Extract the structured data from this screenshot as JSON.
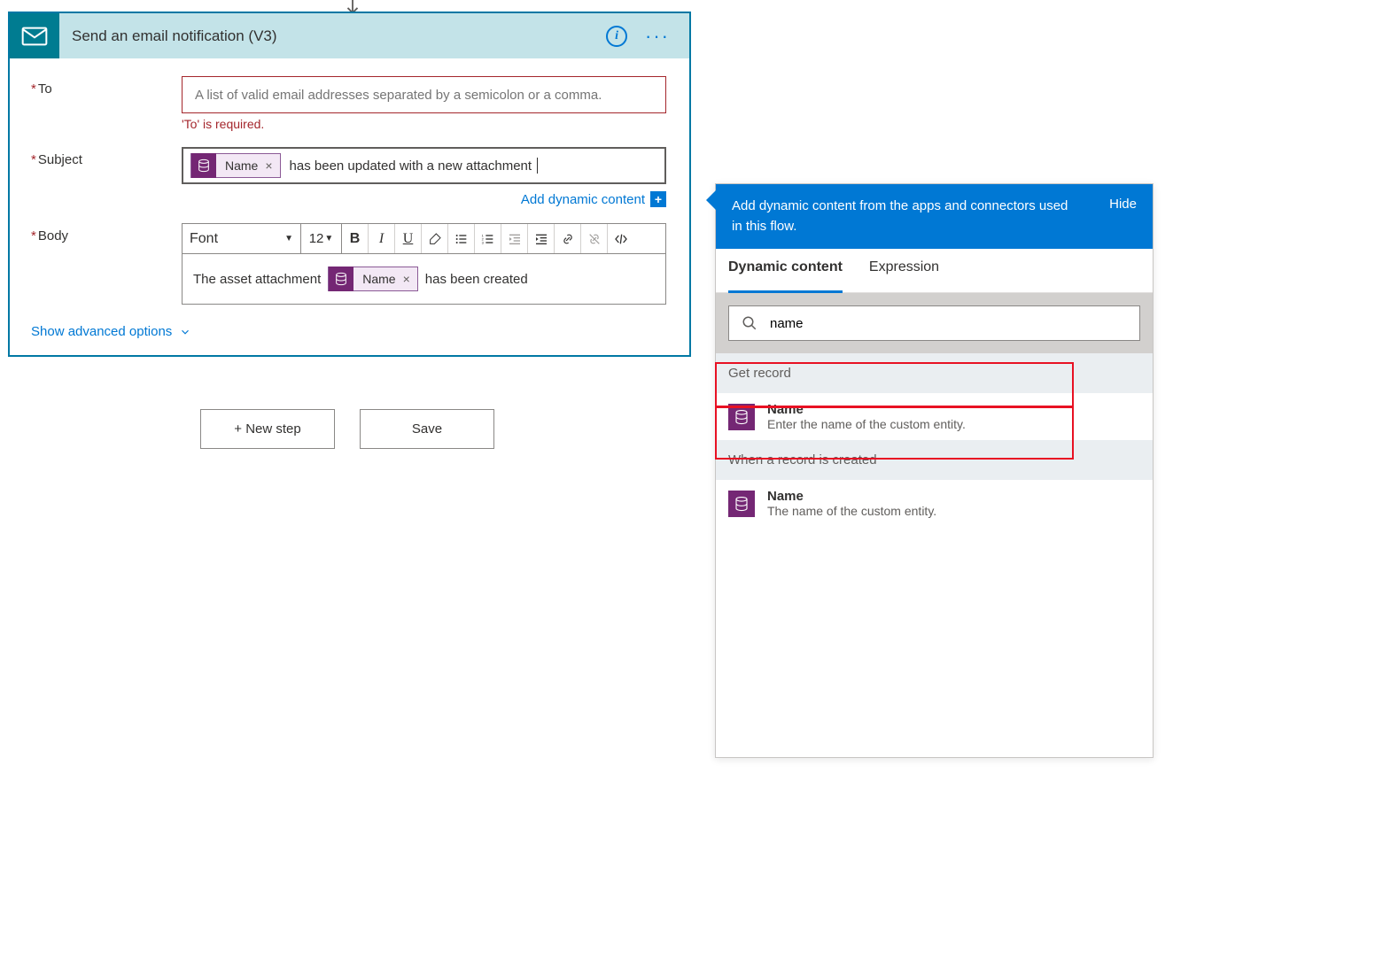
{
  "card": {
    "title": "Send an email notification (V3)",
    "fields": {
      "to": {
        "label": "To",
        "placeholder": "A list of valid email addresses separated by a semicolon or a comma.",
        "error": "'To' is required."
      },
      "subject": {
        "label": "Subject",
        "token": "Name",
        "text": "has been updated with a new attachment"
      },
      "body": {
        "label": "Body",
        "text_before": "The asset attachment",
        "token": "Name",
        "text_after": "has been created"
      }
    },
    "dyn_link": "Add dynamic content",
    "advanced": "Show advanced options",
    "toolbar": {
      "font": "Font",
      "size": "12"
    }
  },
  "buttons": {
    "new_step": "+ New step",
    "save": "Save"
  },
  "panel": {
    "header": "Add dynamic content from the apps and connectors used in this flow.",
    "hide": "Hide",
    "tabs": {
      "dynamic": "Dynamic content",
      "expression": "Expression"
    },
    "search_value": "name",
    "sections": [
      {
        "title": "Get record",
        "items": [
          {
            "name": "Name",
            "desc": "Enter the name of the custom entity."
          }
        ]
      },
      {
        "title": "When a record is created",
        "items": [
          {
            "name": "Name",
            "desc": "The name of the custom entity."
          }
        ]
      }
    ]
  }
}
